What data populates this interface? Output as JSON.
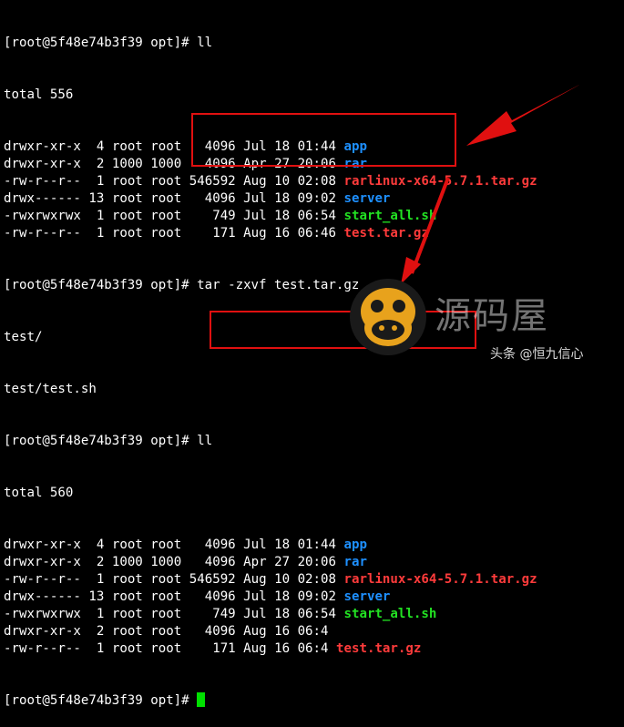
{
  "prompt": "[root@5f48e74b3f39 opt]#",
  "colors": {
    "background": "#000000",
    "text": "#ffffff",
    "directory": "#1e90ff",
    "archive": "#ff3b3b",
    "executable": "#22e022",
    "annotation": "#e01010",
    "cursor": "#00e000"
  },
  "session1": {
    "command": "ll",
    "total": "total 556",
    "entries": [
      {
        "perm": "drwxr-xr-x",
        "links": " 4",
        "owner": "root",
        "group": "root",
        "size": "  4096",
        "date": "Jul 18 01:44",
        "name": "app",
        "type": "dir"
      },
      {
        "perm": "drwxr-xr-x",
        "links": " 2",
        "owner": "1000",
        "group": "1000",
        "size": "  4096",
        "date": "Apr 27 20:06",
        "name": "rar",
        "type": "dir"
      },
      {
        "perm": "-rw-r--r--",
        "links": " 1",
        "owner": "root",
        "group": "root",
        "size": "546592",
        "date": "Aug 10 02:08",
        "name": "rarlinux-x64-5.7.1.tar.gz",
        "type": "archive"
      },
      {
        "perm": "drwx------",
        "links": "13",
        "owner": "root",
        "group": "root",
        "size": "  4096",
        "date": "Jul 18 09:02",
        "name": "server",
        "type": "dir"
      },
      {
        "perm": "-rwxrwxrwx",
        "links": " 1",
        "owner": "root",
        "group": "root",
        "size": "   749",
        "date": "Jul 18 06:54",
        "name": "start_all.sh",
        "type": "exec"
      },
      {
        "perm": "-rw-r--r--",
        "links": " 1",
        "owner": "root",
        "group": "root",
        "size": "   171",
        "date": "Aug 16 06:46",
        "name": "test.tar.gz",
        "type": "archive"
      }
    ]
  },
  "session2": {
    "command": "tar -zxvf test.tar.gz",
    "output": [
      "test/",
      "test/test.sh"
    ]
  },
  "session3": {
    "command": "ll",
    "total": "total 560",
    "entries": [
      {
        "perm": "drwxr-xr-x",
        "links": " 4",
        "owner": "root",
        "group": "root",
        "size": "  4096",
        "date": "Jul 18 01:44",
        "name": "app",
        "type": "dir"
      },
      {
        "perm": "drwxr-xr-x",
        "links": " 2",
        "owner": "1000",
        "group": "1000",
        "size": "  4096",
        "date": "Apr 27 20:06",
        "name": "rar",
        "type": "dir"
      },
      {
        "perm": "-rw-r--r--",
        "links": " 1",
        "owner": "root",
        "group": "root",
        "size": "546592",
        "date": "Aug 10 02:08",
        "name": "rarlinux-x64-5.7.1.tar.gz",
        "type": "archive"
      },
      {
        "perm": "drwx------",
        "links": "13",
        "owner": "root",
        "group": "root",
        "size": "  4096",
        "date": "Jul 18 09:02",
        "name": "server",
        "type": "dir"
      },
      {
        "perm": "-rwxrwxrwx",
        "links": " 1",
        "owner": "root",
        "group": "root",
        "size": "   749",
        "date": "Jul 18 06:54",
        "name": "start_all.sh",
        "type": "exec"
      },
      {
        "perm": "drwxr-xr-x",
        "links": " 2",
        "owner": "root",
        "group": "root",
        "size": "  4096",
        "date": "Aug 16 06:4",
        "name": "",
        "type": "dir"
      },
      {
        "perm": "-rw-r--r--",
        "links": " 1",
        "owner": "root",
        "group": "root",
        "size": "   171",
        "date": "Aug 16 06:4",
        "name": "test.tar.gz",
        "type": "archive"
      }
    ]
  },
  "watermark": {
    "title": "源码屋",
    "credit": "头条 @恒九信心"
  }
}
